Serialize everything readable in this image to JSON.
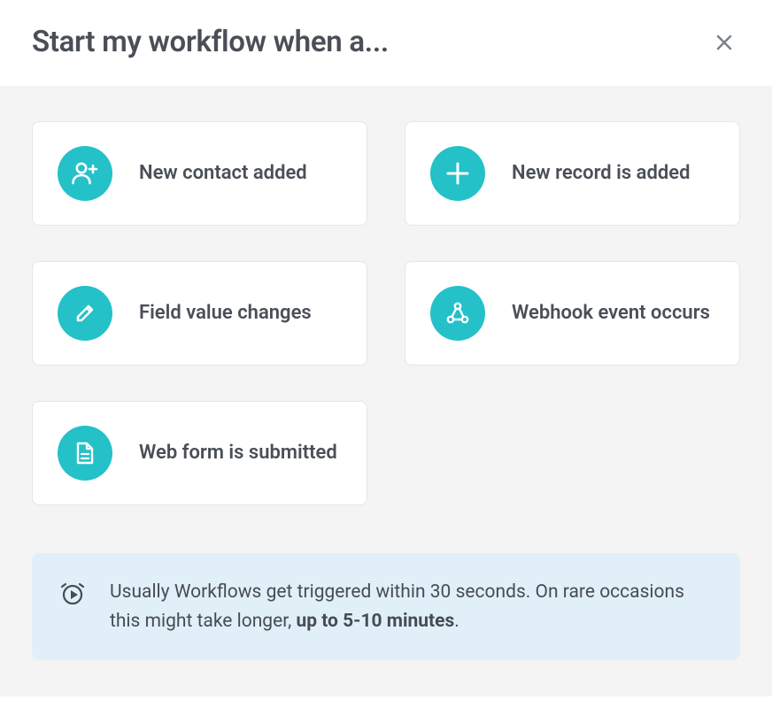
{
  "header": {
    "title": "Start my workflow when a..."
  },
  "triggers": [
    {
      "icon": "person-add",
      "label": "New contact added"
    },
    {
      "icon": "plus",
      "label": "New record is added"
    },
    {
      "icon": "pencil",
      "label": "Field value changes"
    },
    {
      "icon": "webhook",
      "label": "Webhook event occurs"
    },
    {
      "icon": "form",
      "label": "Web form is submitted"
    }
  ],
  "info": {
    "text_before": "Usually Workflows get triggered within 30 seconds. On rare occasions this might take longer, ",
    "text_bold": "up to 5-10 minutes",
    "text_after": "."
  },
  "colors": {
    "accent": "#24c1c9",
    "info_bg": "#e1f0f8"
  }
}
